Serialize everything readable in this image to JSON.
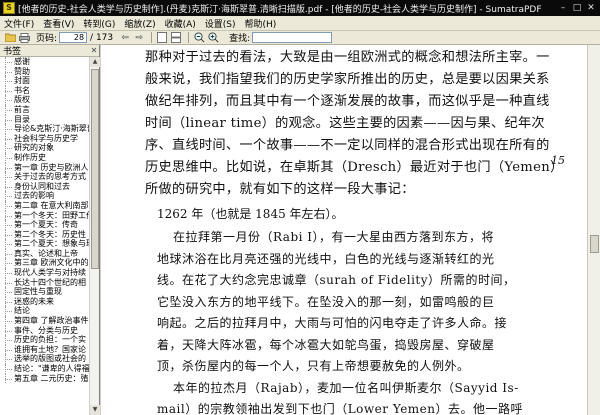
{
  "window": {
    "app_icon": "sumatra-icon",
    "title": "[他者的历史-社会人类学与历史制作].(丹麦)克斯汀·海斯翠普.清晰扫描版.pdf - [他者的历史-社会人类学与历史制作] - SumatraPDF",
    "buttons": [
      "minimize-icon",
      "maximize-icon",
      "close-icon"
    ]
  },
  "menu": [
    "文件(F)",
    "查看(V)",
    "转到(G)",
    "缩放(Z)",
    "收藏(A)",
    "设置(S)",
    "帮助(H)"
  ],
  "toolbar": {
    "page_label": "页码:",
    "page_value": "28",
    "page_total": "/ 173",
    "search_label": "查找:"
  },
  "sidebar": {
    "title": "书签",
    "items": [
      "感谢",
      "赞助",
      "封面",
      "书名",
      "版权",
      "前言",
      "目录",
      "导论&克斯汀·海斯翠普",
      "社会科学与历史学",
      "研究的对象",
      "制作历史",
      "第一章 历史与欧洲人",
      "关于过去的思考方式",
      "身份认同和过去",
      "过去的影响",
      "第二章 在意大利南部",
      "第一个冬天：田野工作",
      "第一个夏天：传奇",
      "第二个冬天：历史性",
      "第二个夏天：想象与现实",
      "真实、论述和上帝",
      "第三章 欧洲文化中的",
      "现代人类学与对持续",
      "长达十四个世纪的相",
      "固定性与重现",
      "迷惑的未来",
      "结论",
      "第四章 了解政治事件",
      "事件、分类与历史",
      "历史的负担：一个实",
      "谁拥有土地？国家论",
      "选举的版图或社会的",
      "结论：\"谦卑的人得福\"",
      "第五章 二元历史：殖"
    ]
  },
  "document": {
    "para_lines": [
      "那种对于过去的看法，大致是由一组欧洲式的概念和想法所主宰。一",
      "般来说，我们指望我们的历史学家所推出的历史，总是要以因果关系",
      "做纪年排列，而且其中有一个逐渐发展的故事，而这似乎是一种直线",
      "时间（linear time）的观念。这些主要的因素——因与果、纪年次",
      "序、直线时间、一个故事——不一定以同样的混合形式出现在所有的",
      "历史思维中。比如说，在卓斯其（Dresch）最近对于也门（Yemen）",
      "所做的研究中，就有如下的这样一段大事记："
    ],
    "page_number": "15",
    "quote_title": "1262 年（也就是 1845 年左右）。",
    "quote_lines": [
      {
        "text": "在拉拜第一月份（Rabi I），有一大星由西方落到东方，将",
        "indent": true
      },
      {
        "text": "地球沐浴在比月亮还强的光线中，白色的光线与逐渐转红的光",
        "indent": false
      },
      {
        "text": "线。在花了大约念完忠诚章（surah of Fidelity）所需的时间，",
        "indent": false
      },
      {
        "text": "它坠没入东方的地平线下。在坠没入的那一刻，如雷鸣般的巨",
        "indent": false
      },
      {
        "text": "响起。之后的拉拜月中，大雨与可怕的闪电夺走了许多人命。接",
        "indent": false
      },
      {
        "text": "着，天降大阵冰雹，每个冰雹大如鸵鸟蛋，捣毁房屋、穿破屋",
        "indent": false
      },
      {
        "text": "顶，杀伤屋内的每一个人，只有上帝想要赦免的人例外。",
        "indent": false
      },
      {
        "text": "本年的拉杰月（Rajab），麦加一位名叫伊斯麦尔（Sayyid Is-",
        "indent": true
      },
      {
        "text": "mail）的宗教领袖出发到下也门（Lower Yemen）去。他一路呼",
        "indent": false
      }
    ]
  }
}
